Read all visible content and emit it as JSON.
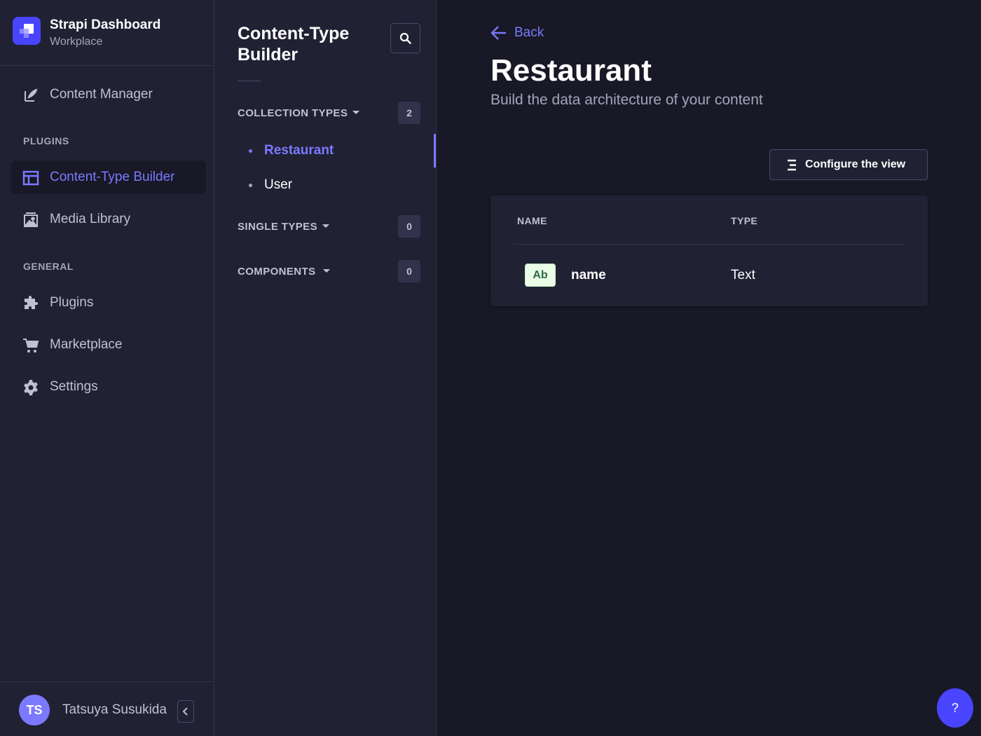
{
  "brand": {
    "title": "Strapi Dashboard",
    "subtitle": "Workplace"
  },
  "mainnav": {
    "content_manager": "Content Manager",
    "plugins_section": "PLUGINS",
    "content_type_builder": "Content-Type Builder",
    "media_library": "Media Library",
    "general_section": "GENERAL",
    "plugins": "Plugins",
    "marketplace": "Marketplace",
    "settings": "Settings"
  },
  "user": {
    "initials": "TS",
    "name": "Tatsuya Susukida"
  },
  "subnav": {
    "title": "Content-Type Builder",
    "collection_types": {
      "label": "COLLECTION TYPES",
      "count": "2",
      "items": [
        "Restaurant",
        "User"
      ]
    },
    "single_types": {
      "label": "SINGLE TYPES",
      "count": "0"
    },
    "components": {
      "label": "COMPONENTS",
      "count": "0"
    }
  },
  "main": {
    "back_label": "Back",
    "title": "Restaurant",
    "subtitle": "Build the data architecture of your content",
    "configure_label": "Configure the view",
    "table": {
      "headers": [
        "NAME",
        "TYPE"
      ],
      "rows": [
        {
          "badge": "Ab",
          "name": "name",
          "type": "Text"
        }
      ]
    }
  },
  "help": {
    "label": "?"
  },
  "colors": {
    "accent": "#7b79ff",
    "primary": "#4945ff",
    "background": "#181826",
    "surface": "#212134"
  },
  "icons": [
    "strapi-logo-icon",
    "feather-icon",
    "layout-icon",
    "image-icon",
    "puzzle-icon",
    "cart-icon",
    "gear-icon",
    "search-icon",
    "arrow-left-icon",
    "list-icon",
    "chevron-left-icon"
  ]
}
